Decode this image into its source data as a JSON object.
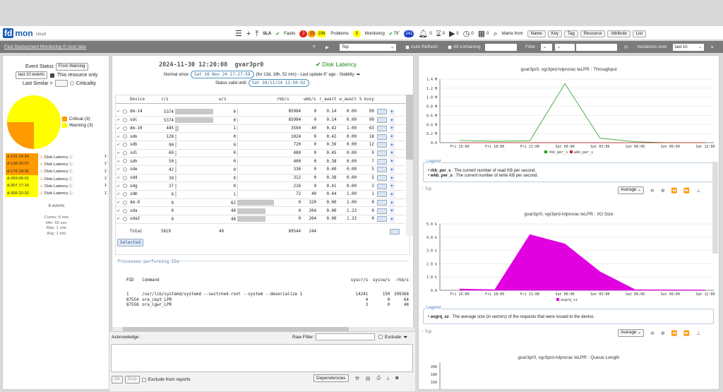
{
  "header": {
    "logo_fd": "fd",
    "logo_mon": "mon",
    "logo_cloud": "cloud",
    "sla": "SLA",
    "faults": "Faults",
    "faults_red": "2",
    "faults_orange": "13",
    "faults_yellow": "198",
    "problems": "Problems",
    "problems_count": "5",
    "monitoring": "Monitoring",
    "monitoring_pct": "79`",
    "monitoring_count": "241",
    "bell_count": "0",
    "hourglass_count": "0",
    "play_count": "0",
    "clock_count": "0",
    "cal_count": "0",
    "matrix_from": "Matrix from",
    "matrix_btns": [
      "Name",
      "Key",
      "Tag",
      "Resource",
      "Attribute",
      "List"
    ]
  },
  "menubar": {
    "title": "Fast Deployment Monitoring © ncor labs",
    "top": "Top",
    "auto_refresh": "Auto Refresh",
    "all_containing": "All containing",
    "filter": "Filter :",
    "variations_over": "Variations over",
    "range": "last 1h"
  },
  "left": {
    "event_status": "Event Status",
    "from_warning": "From Warning",
    "last_10": "last 10 events",
    "this_resource": "This resource only",
    "last_similar": "Last Similar >",
    "criticality": "Criticality",
    "pie_legend": [
      {
        "label": "Critical (3)",
        "color": "#ff9a00"
      },
      {
        "label": "Warning (3)",
        "color": "#ffff00"
      }
    ],
    "pie": {
      "critical": 3,
      "warning": 3
    },
    "events": [
      {
        "id": "d-125 14:24",
        "name": "Disk Latency",
        "suffix": "1'",
        "color": "#ff9a00"
      },
      {
        "id": "d-138 20:07",
        "name": "Disk Latency",
        "suffix": "1'",
        "color": "#ff9a00"
      },
      {
        "id": "d-176 19:36",
        "name": "Disk Latency",
        "suffix": "1'",
        "color": "#ff9a00"
      },
      {
        "id": "d-269 06:01",
        "name": "Disk Latency",
        "suffix": "1'",
        "color": "#ffff00"
      },
      {
        "id": "d-307 17:16",
        "name": "Disk Latency",
        "suffix": "1'",
        "color": "#ffff00"
      },
      {
        "id": "d-309 22:32",
        "name": "Disk Latency",
        "suffix": "1'",
        "color": "#ffff00"
      }
    ],
    "events_count": "6 events",
    "cumul": "Cumul :6 min",
    "min": "Min :55 sec",
    "max": "Max :1 min",
    "avg": "Avg :1 min"
  },
  "detail": {
    "timestamp": "2024-11-30 12:20:08",
    "host": "gvar3pr0",
    "status": "Disk Latency",
    "normal_since_label": "Normal since",
    "normal_since": "Sat 16 Nov 24 17:27:59",
    "normal_since_rest": "(for 13d, 18h, 52 min) - Last update 6\" ago - Stability",
    "valid_until_label": "Status valid until",
    "valid_until": "Sat 30/11/24 12:50:02",
    "columns": [
      "Device",
      "r/s",
      "w/s",
      "rkb/s",
      "wkb/s",
      "r_await",
      "w_await",
      "% busy"
    ],
    "rows": [
      {
        "dev": "dm-14",
        "rs": "5374",
        "rbar": 1.0,
        "ws": "0",
        "rkb": "85984",
        "wkb": "0",
        "ra": "0.14",
        "wa": "0.00",
        "busy": "99"
      },
      {
        "dev": "sdc",
        "rs": "5374",
        "rbar": 1.0,
        "ws": "0",
        "rkb": "85984",
        "wkb": "0",
        "ra": "0.14",
        "wa": "0.00",
        "busy": "99"
      },
      {
        "dev": "dm-10",
        "rs": "445",
        "rbar": 0.1,
        "ws": "1",
        "rkb": "3560",
        "wkb": "40",
        "ra": "0.42",
        "wa": "1.00",
        "busy": "63"
      },
      {
        "dev": "sdk",
        "rs": "128",
        "rbar": 0.03,
        "ws": "0",
        "rkb": "1024",
        "wkb": "0",
        "ra": "0.42",
        "wa": "0.00",
        "busy": "18"
      },
      {
        "dev": "sdb",
        "rs": "90",
        "rbar": 0.02,
        "ws": "0",
        "rkb": "720",
        "wkb": "0",
        "ra": "0.39",
        "wa": "0.00",
        "busy": "12"
      },
      {
        "dev": "sdl",
        "rs": "60",
        "rbar": 0.015,
        "ws": "0",
        "rkb": "480",
        "wkb": "0",
        "ra": "0.45",
        "wa": "0.00",
        "busy": "9"
      },
      {
        "dev": "sdh",
        "rs": "50",
        "rbar": 0.012,
        "ws": "0",
        "rkb": "400",
        "wkb": "0",
        "ra": "0.38",
        "wa": "0.00",
        "busy": "7"
      },
      {
        "dev": "sde",
        "rs": "42",
        "rbar": 0.01,
        "ws": "0",
        "rkb": "336",
        "wkb": "0",
        "ra": "0.40",
        "wa": "0.00",
        "busy": "5"
      },
      {
        "dev": "sdd",
        "rs": "39",
        "rbar": 0.01,
        "ws": "0",
        "rkb": "312",
        "wkb": "0",
        "ra": "0.38",
        "wa": "0.00",
        "busy": "5"
      },
      {
        "dev": "sdg",
        "rs": "27",
        "rbar": 0.007,
        "ws": "0",
        "rkb": "216",
        "wkb": "0",
        "ra": "0.41",
        "wa": "0.00",
        "busy": "3"
      },
      {
        "dev": "sdm",
        "rs": "9",
        "rbar": 0.002,
        "ws": "1",
        "rkb": "72",
        "wkb": "40",
        "ra": "0.44",
        "wa": "1.00",
        "busy": "1"
      },
      {
        "dev": "dm-0",
        "rs": "0",
        "rbar": 0,
        "ws": "62",
        "rkb": "0",
        "wkb": "320",
        "ra": "0.00",
        "wa": "1.00",
        "busy": "0",
        "wbar": 0.93
      },
      {
        "dev": "sda",
        "rs": "0",
        "rbar": 0,
        "ws": "48",
        "rkb": "0",
        "wkb": "204",
        "ra": "0.00",
        "wa": "1.23",
        "busy": "0",
        "wbar": 0.72
      },
      {
        "dev": "sda2",
        "rs": "0",
        "rbar": 0,
        "ws": "48",
        "rkb": "0",
        "wkb": "204",
        "ra": "0.00",
        "wa": "1.23",
        "busy": "0",
        "wbar": 0.72
      }
    ],
    "total_label": "Total",
    "total_rs": "5819",
    "total_ws": "49",
    "total_rkb": "89544",
    "total_wkb": "244",
    "selected": "Selected",
    "proc_title": "Processes performing IOs",
    "proc_cols": [
      "PID",
      "Command",
      "syscr/s",
      "syscw/s",
      "rkb/s"
    ],
    "procs": [
      {
        "pid": "1",
        "cmd": "/usr/lib/systemd/systemd --switched-root --system --deserialize 1",
        "cr": "14241",
        "cw": "150",
        "rkb": "209368"
      },
      {
        "pid": "87554",
        "cmd": "ora_ckpt_LPR",
        "cr": "4",
        "cw": "0",
        "rkb": "64"
      },
      {
        "pid": "87558",
        "cmd": "ora_lgwr_LPR",
        "cr": "3",
        "cw": "0",
        "rkb": "48"
      }
    ]
  },
  "ack": {
    "label": "Acknowledge :",
    "raw_filter": "Raw Filter :",
    "exclude": "Exclude",
    "ok": "Ok",
    "drop": "Drop",
    "exclude_reports": "Exclude from reports",
    "dependencies": "Dependencies"
  },
  "right": {
    "chart1_title": "gvar3pr0, vgr3prd-lvlprorac leLPR : Throughput",
    "legend_label": "Legend",
    "top": "↑ Top",
    "average": "Average",
    "chart1_legend": [
      {
        "k": "rkb_per_s",
        "d": ": The current number of read KB per second."
      },
      {
        "k": "wkb_per_s",
        "d": ": The current number of write KB per second."
      }
    ],
    "chart2_title": "gvar3pr0, vgr3prd-lvlprorac leLPR : I/O Size",
    "chart2_legend": [
      {
        "k": "avgrq_sz",
        "d": ": The average size (in sectors) of the requests that were issued to the device."
      }
    ],
    "chart3_title": "gvar3pr0, vgr3prd-lvlprorac leLPR : Queue Length"
  },
  "chart_data": [
    {
      "type": "line",
      "title": "gvar3pr0, vgr3prd-lvlprorac leLPR : Throughput",
      "x": [
        "Fri 15:00",
        "Fri 18:00",
        "Fri 21:00",
        "Sat 00:00",
        "Sat 03:00",
        "Sat 06:00",
        "Sat 09:00",
        "Sat 12:00"
      ],
      "yticks": [
        "0.0",
        "0.2 M",
        "0.4 M",
        "0.6 M",
        "0.8 M",
        "1.0 M",
        "1.2 M",
        "1.4 M"
      ],
      "ylim": [
        0,
        1.4
      ],
      "series": [
        {
          "name": "rkb_per_s",
          "color": "#22a022",
          "values": [
            0.05,
            0.03,
            0.04,
            1.3,
            0.1,
            0.02,
            0.0,
            0.0
          ]
        },
        {
          "name": "wkb_per_s",
          "color": "#cc2222",
          "values": [
            0.0,
            0.0,
            0.0,
            0.0,
            0.0,
            0.0,
            0.0,
            0.0
          ]
        }
      ]
    },
    {
      "type": "area",
      "title": "gvar3pr0, vgr3prd-lvlprorac leLPR : I/O Size",
      "x": [
        "Fri 15:00",
        "Fri 18:00",
        "Fri 21:00",
        "Sat 00:00",
        "Sat 03:00",
        "Sat 06:00",
        "Sat 09:00",
        "Sat 12:00"
      ],
      "yticks": [
        "0.0",
        "1.0 k",
        "2.0 k",
        "3.0 k",
        "4.0 k",
        "5.0 k"
      ],
      "ylim": [
        0,
        5000
      ],
      "series": [
        {
          "name": "avgrq_sz",
          "color": "#e000e0",
          "values": [
            100,
            50,
            4200,
            3500,
            1400,
            50,
            40,
            30
          ]
        }
      ]
    },
    {
      "type": "line",
      "title": "gvar3pr0, vgr3prd-lvlprorac leLPR : Queue Length",
      "yticks": [
        "160",
        "180",
        "200"
      ],
      "series": []
    }
  ]
}
